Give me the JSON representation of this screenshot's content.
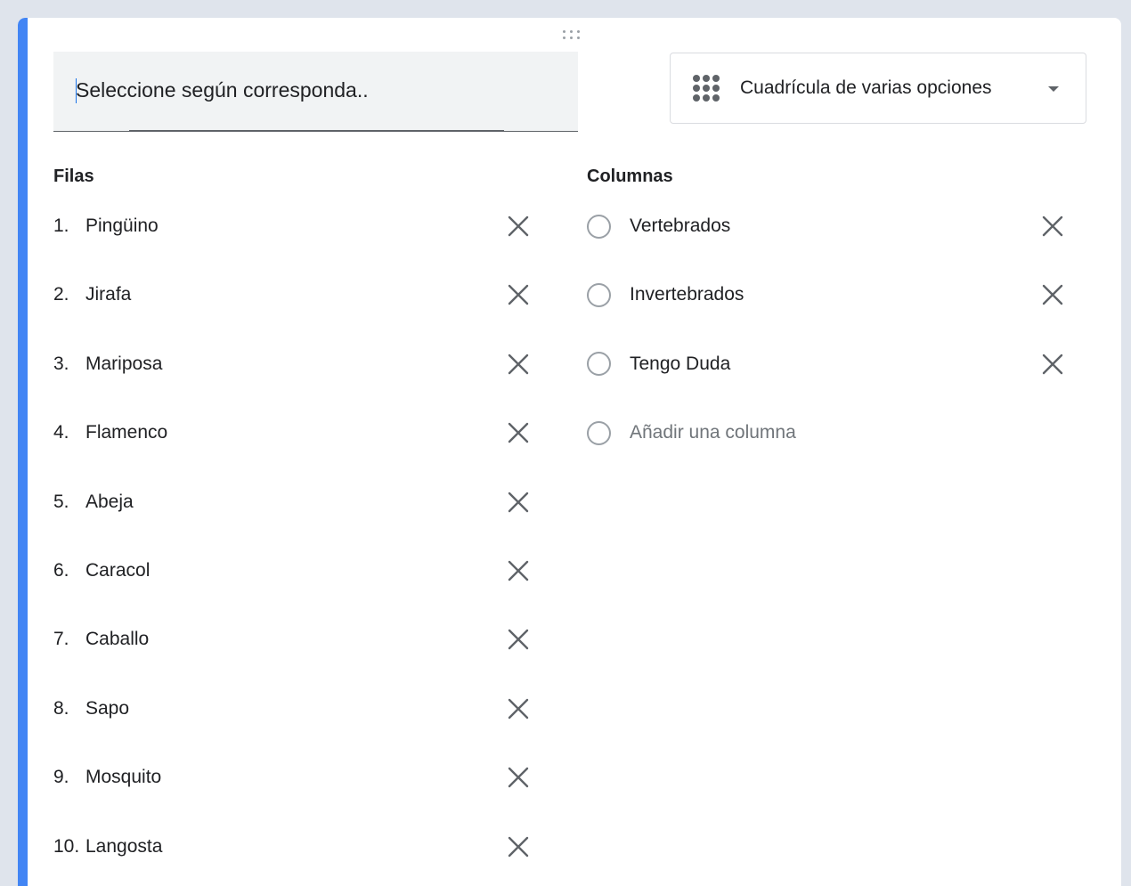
{
  "question": {
    "placeholder": "Seleccione según corresponda.."
  },
  "type_selector": {
    "label": "Cuadrícula de varias opciones",
    "icon": "grid-icon"
  },
  "rows_section": {
    "heading": "Filas",
    "items": [
      {
        "number": "1.",
        "label": "Pingüino"
      },
      {
        "number": "2.",
        "label": "Jirafa"
      },
      {
        "number": "3.",
        "label": "Mariposa"
      },
      {
        "number": "4.",
        "label": "Flamenco"
      },
      {
        "number": "5.",
        "label": "Abeja"
      },
      {
        "number": "6.",
        "label": "Caracol"
      },
      {
        "number": "7.",
        "label": "Caballo"
      },
      {
        "number": "8.",
        "label": "Sapo"
      },
      {
        "number": "9.",
        "label": "Mosquito"
      },
      {
        "number": "10.",
        "label": "Langosta"
      }
    ]
  },
  "columns_section": {
    "heading": "Columnas",
    "items": [
      {
        "label": "Vertebrados"
      },
      {
        "label": "Invertebrados"
      },
      {
        "label": "Tengo Duda"
      }
    ],
    "add_column_label": "Añadir una columna"
  },
  "colors": {
    "accent": "#4285f4",
    "text": "#202124",
    "muted": "#70757a",
    "icon": "#5f6368"
  }
}
